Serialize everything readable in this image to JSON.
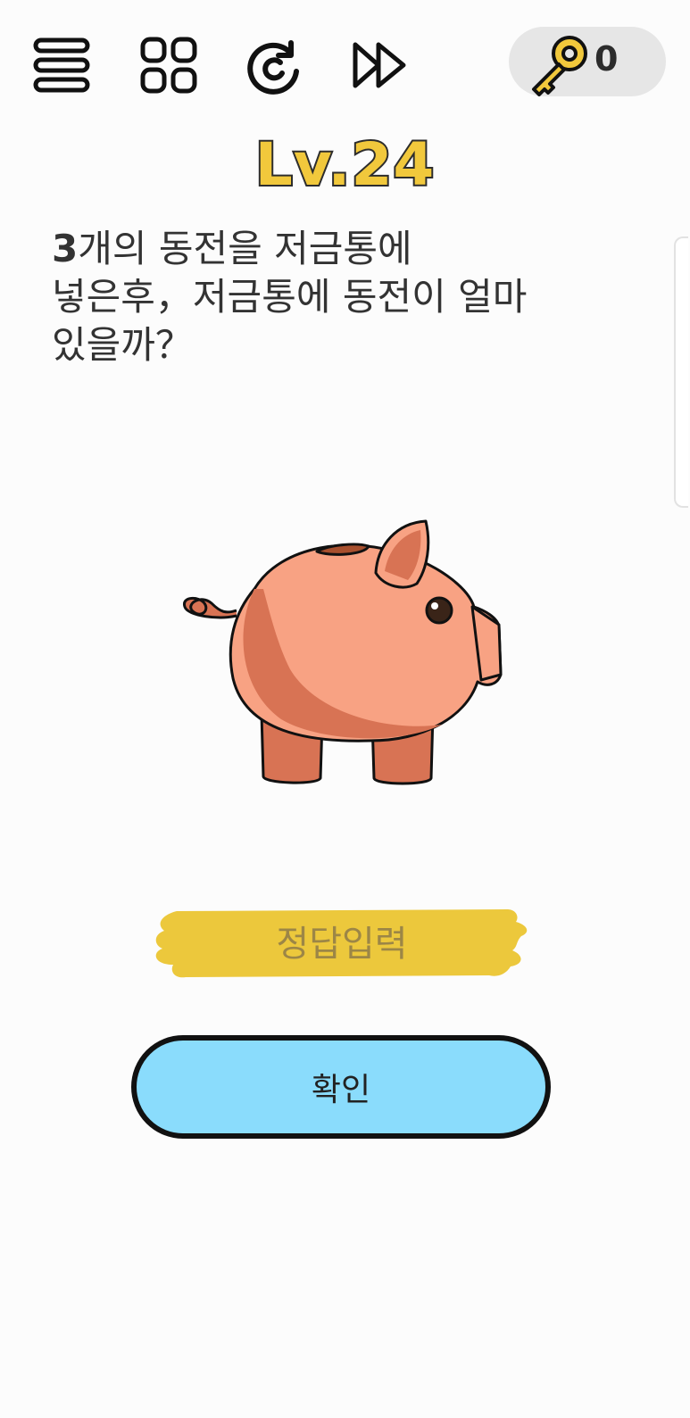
{
  "toolbar": {
    "menu_icon": "menu-icon",
    "levels_icon": "grid-icon",
    "restart_icon": "restart-icon",
    "skip_icon": "skip-icon",
    "key_icon": "key-icon",
    "key_count": "0"
  },
  "level": {
    "title": "Lv.24"
  },
  "question": {
    "number": "3",
    "text": "개의 동전을 저금통에\n넣은후，저금통에 동전이 얼마\n있을까？"
  },
  "answer": {
    "placeholder": "정답입력"
  },
  "confirm": {
    "label": "확인"
  },
  "colors": {
    "level_yellow": "#f1c83c",
    "answer_yellow": "#ecc83c",
    "confirm_blue": "#8adcfc",
    "pig_body": "#f8a283",
    "pig_shade": "#d87354"
  }
}
